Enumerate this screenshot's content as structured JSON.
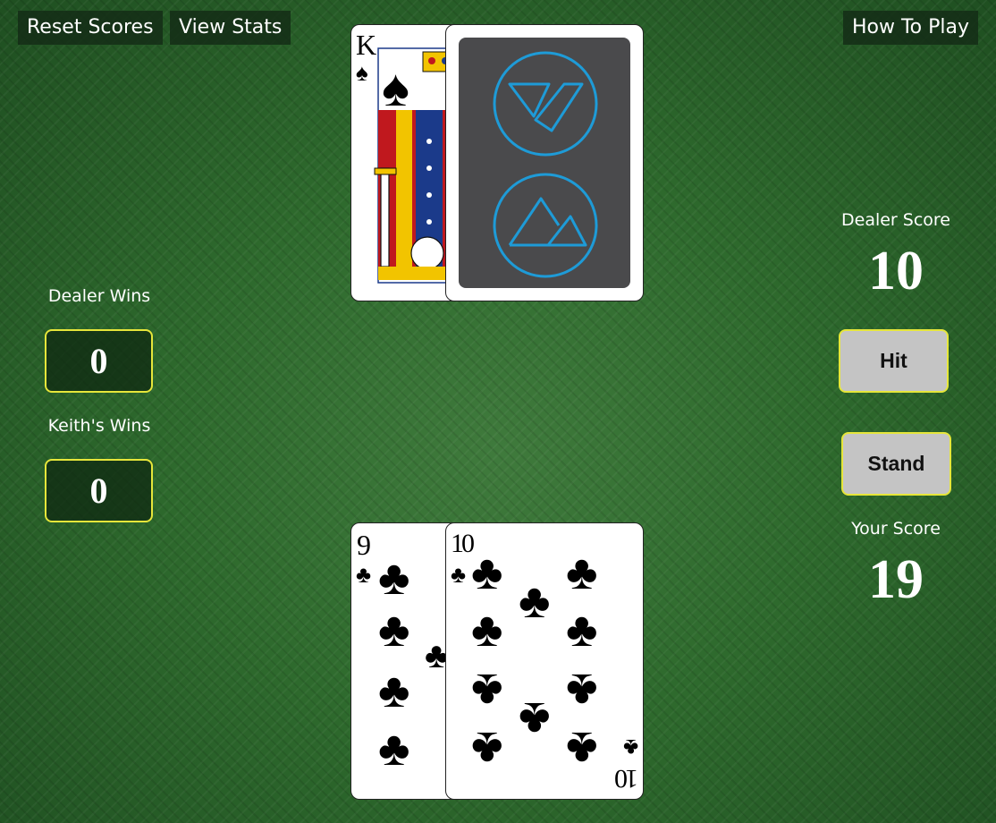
{
  "toolbar": {
    "reset_label": "Reset Scores",
    "stats_label": "View Stats",
    "howto_label": "How To Play"
  },
  "scoreboard": {
    "dealer_wins_label": "Dealer Wins",
    "dealer_wins_value": "0",
    "player_wins_label": "Keith's Wins",
    "player_wins_value": "0"
  },
  "scores": {
    "dealer_label": "Dealer Score",
    "dealer_value": "10",
    "player_label": "Your Score",
    "player_value": "19"
  },
  "actions": {
    "hit_label": "Hit",
    "stand_label": "Stand"
  },
  "dealer_hand": [
    {
      "rank": "K",
      "suit": "spades",
      "suit_symbol": "♠",
      "face_up": true
    },
    {
      "face_up": false
    }
  ],
  "player_hand": [
    {
      "rank": "9",
      "suit": "clubs",
      "suit_symbol": "♣",
      "face_up": true
    },
    {
      "rank": "10",
      "suit": "clubs",
      "suit_symbol": "♣",
      "face_up": true
    }
  ],
  "colors": {
    "accent_border": "#e6e63a",
    "card_back": "#4a4a4c",
    "card_back_logo": "#1e9bd7",
    "button_fill": "#c4c4c4"
  }
}
